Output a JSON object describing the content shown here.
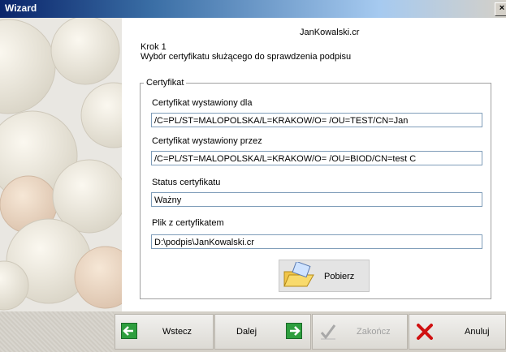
{
  "window": {
    "title": "Wizard",
    "close_label": "×"
  },
  "header": {
    "filename": "JanKowalski.cr",
    "step": "Krok 1",
    "description": "Wybór certyfikatu służącego do sprawdzenia podpisu"
  },
  "group": {
    "legend": "Certyfikat",
    "issued_for_label": "Certyfikat wystawiony dla",
    "issued_for_value": "/C=PL/ST=MALOPOLSKA/L=KRAKOW/O=                    /OU=TEST/CN=Jan",
    "issued_by_label": "Certyfikat wystawiony przez",
    "issued_by_value": "/C=PL/ST=MALOPOLSKA/L=KRAKOW/O=                    /OU=BIOD/CN=test C",
    "status_label": "Status certyfikatu",
    "status_value": "Ważny",
    "file_label": "Plik z certyfikatem",
    "file_value": "D:\\podpis\\JanKowalski.cr",
    "fetch_label": "Pobierz"
  },
  "buttons": {
    "back": "Wstecz",
    "next": "Dalej",
    "finish": "Zakończ",
    "cancel": "Anuluj"
  },
  "colors": {
    "title_start": "#0a246a",
    "arrow_green": "#2e9e3e",
    "cancel_red": "#d01010"
  }
}
